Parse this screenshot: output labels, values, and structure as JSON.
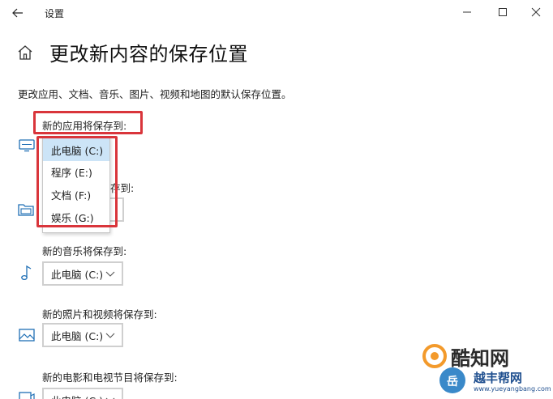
{
  "window": {
    "title": "设置"
  },
  "page": {
    "title": "更改新内容的保存位置",
    "description": "更改应用、文档、音乐、图片、视频和地图的默认保存位置。"
  },
  "sections": {
    "apps": {
      "label": "新的应用将保存到:",
      "options": [
        "此电脑 (C:)",
        "程序 (E:)",
        "文档 (F:)",
        "娱乐 (G:)"
      ],
      "selected_index": 0
    },
    "docs": {
      "label_partial": "存到:",
      "value_partial": ""
    },
    "music": {
      "label": "新的音乐将保存到:",
      "value": "此电脑 (C:)"
    },
    "photos": {
      "label": "新的照片和视频将保存到:",
      "value": "此电脑 (C:)"
    },
    "movies": {
      "label": "新的电影和电视节目将保存到:",
      "value": "此电脑 (C:)"
    }
  },
  "watermark": {
    "main": "酷知网",
    "sub_cn": "越丰帮网",
    "url": "www.yueyangbang.com"
  },
  "colors": {
    "highlight": "#d9353b",
    "selected_bg": "#cce4f7",
    "icon_blue": "#1f6fb5"
  }
}
